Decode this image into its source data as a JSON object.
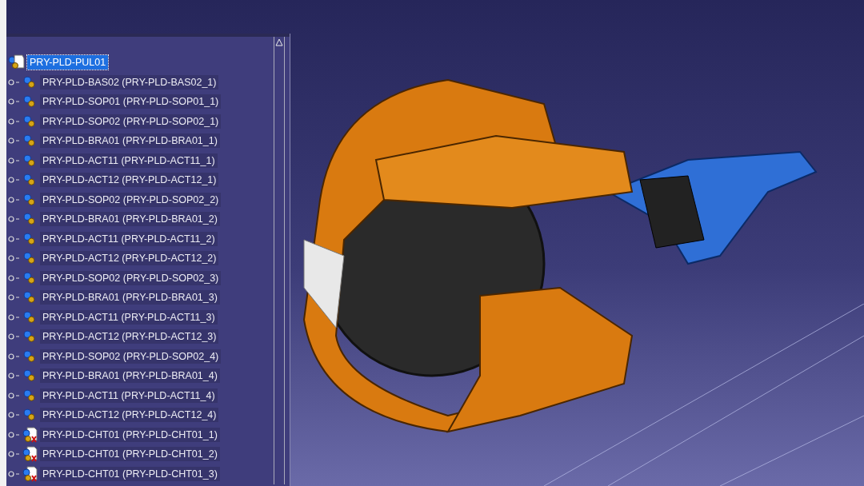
{
  "tree": {
    "root": {
      "label": "PRY-PLD-PUL01",
      "selected": true,
      "kind": "product"
    },
    "children": [
      {
        "label": "PRY-PLD-BAS02 (PRY-PLD-BAS02_1)",
        "kind": "product",
        "selected": false
      },
      {
        "label": "PRY-PLD-SOP01 (PRY-PLD-SOP01_1)",
        "kind": "product",
        "selected": false
      },
      {
        "label": "PRY-PLD-SOP02 (PRY-PLD-SOP02_1)",
        "kind": "product",
        "selected": false
      },
      {
        "label": "PRY-PLD-BRA01 (PRY-PLD-BRA01_1)",
        "kind": "product",
        "selected": false
      },
      {
        "label": "PRY-PLD-ACT11 (PRY-PLD-ACT11_1)",
        "kind": "product",
        "selected": false
      },
      {
        "label": "PRY-PLD-ACT12 (PRY-PLD-ACT12_1)",
        "kind": "product",
        "selected": false
      },
      {
        "label": "PRY-PLD-SOP02 (PRY-PLD-SOP02_2)",
        "kind": "product",
        "selected": false
      },
      {
        "label": "PRY-PLD-BRA01 (PRY-PLD-BRA01_2)",
        "kind": "product",
        "selected": false
      },
      {
        "label": "PRY-PLD-ACT11 (PRY-PLD-ACT11_2)",
        "kind": "product",
        "selected": false
      },
      {
        "label": "PRY-PLD-ACT12 (PRY-PLD-ACT12_2)",
        "kind": "product",
        "selected": false
      },
      {
        "label": "PRY-PLD-SOP02 (PRY-PLD-SOP02_3)",
        "kind": "product",
        "selected": false
      },
      {
        "label": "PRY-PLD-BRA01 (PRY-PLD-BRA01_3)",
        "kind": "product",
        "selected": false
      },
      {
        "label": "PRY-PLD-ACT11 (PRY-PLD-ACT11_3)",
        "kind": "product",
        "selected": false
      },
      {
        "label": "PRY-PLD-ACT12 (PRY-PLD-ACT12_3)",
        "kind": "product",
        "selected": false
      },
      {
        "label": "PRY-PLD-SOP02 (PRY-PLD-SOP02_4)",
        "kind": "product",
        "selected": false
      },
      {
        "label": "PRY-PLD-BRA01 (PRY-PLD-BRA01_4)",
        "kind": "product",
        "selected": false
      },
      {
        "label": "PRY-PLD-ACT11 (PRY-PLD-ACT11_4)",
        "kind": "product",
        "selected": false
      },
      {
        "label": "PRY-PLD-ACT12 (PRY-PLD-ACT12_4)",
        "kind": "product",
        "selected": false
      },
      {
        "label": "PRY-PLD-CHT01 (PRY-PLD-CHT01_1)",
        "kind": "part",
        "selected": false
      },
      {
        "label": "PRY-PLD-CHT01 (PRY-PLD-CHT01_2)",
        "kind": "part",
        "selected": false
      },
      {
        "label": "PRY-PLD-CHT01 (PRY-PLD-CHT01_3)",
        "kind": "part",
        "selected": false
      }
    ]
  }
}
